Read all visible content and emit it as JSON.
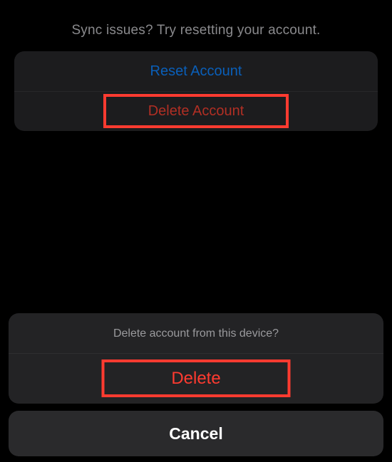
{
  "hint": "Sync issues? Try resetting your account.",
  "account": {
    "reset_label": "Reset Account",
    "delete_label": "Delete Account"
  },
  "sheet": {
    "title": "Delete account from this device?",
    "delete_label": "Delete",
    "cancel_label": "Cancel"
  },
  "colors": {
    "highlight": "#ff3b30",
    "link": "#0a5fb9",
    "destructive": "#ff3b30"
  }
}
